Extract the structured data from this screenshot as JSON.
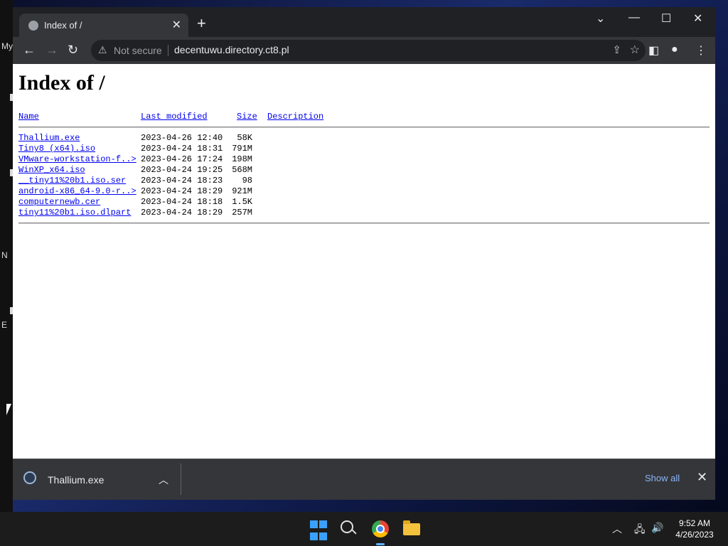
{
  "desktop": {
    "labels": [
      "My",
      "N",
      "E"
    ]
  },
  "browser": {
    "tab": {
      "title": "Index of /",
      "favicon": "globe-icon"
    },
    "window_controls": [
      "tab-search",
      "minimize",
      "maximize",
      "close"
    ],
    "omnibox": {
      "security_label": "Not secure",
      "url": "decentuwu.directory.ct8.pl"
    }
  },
  "page": {
    "heading": "Index of /",
    "columns": {
      "name": "Name",
      "last_modified": "Last modified",
      "size": "Size",
      "description": "Description"
    },
    "rows": [
      {
        "name": "Thallium.exe",
        "date": "2023-04-26 12:40",
        "size": "58K"
      },
      {
        "name": "Tiny8 (x64).iso",
        "date": "2023-04-24 18:31",
        "size": "791M"
      },
      {
        "name": "VMware-workstation-f..>",
        "date": "2023-04-26 17:24",
        "size": "198M"
      },
      {
        "name": "WinXP_x64.iso",
        "date": "2023-04-24 19:25",
        "size": "568M"
      },
      {
        "name": "__tiny11%20b1.iso.ser",
        "date": "2023-04-24 18:23",
        "size": "98"
      },
      {
        "name": "android-x86_64-9.0-r..>",
        "date": "2023-04-24 18:29",
        "size": "921M"
      },
      {
        "name": "computernewb.cer",
        "date": "2023-04-24 18:18",
        "size": "1.5K"
      },
      {
        "name": "tiny11%20b1.iso.dlpart",
        "date": "2023-04-24 18:29",
        "size": "257M"
      }
    ]
  },
  "downloads": {
    "item_name": "Thallium.exe",
    "show_all": "Show all"
  },
  "taskbar": {
    "apps": [
      "start",
      "search",
      "chrome",
      "file-explorer"
    ],
    "clock": {
      "time": "9:52 AM",
      "date": "4/26/2023"
    }
  }
}
